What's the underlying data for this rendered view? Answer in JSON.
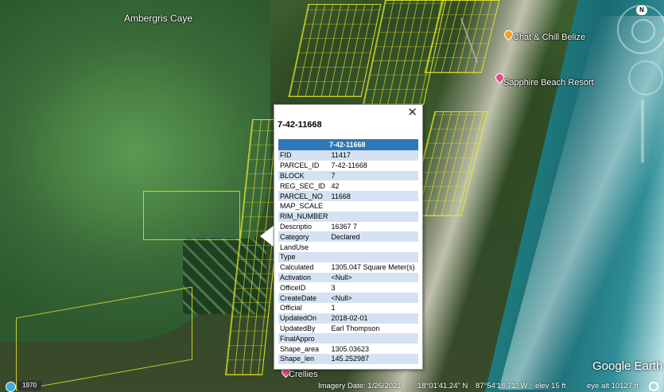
{
  "map": {
    "labels": {
      "ambergris": "Ambergris Caye",
      "chat_chill": "Chat & Chill Belize",
      "sapphire": "Sapphire Beach Resort",
      "crellies": "Crellies"
    },
    "pin_colors": {
      "chat_chill": "#f0a030",
      "sapphire": "#e24b8c",
      "crellies": "#e24b8c"
    },
    "compass_letter": "N",
    "logo": "Google Earth"
  },
  "popup": {
    "close_glyph": "✕",
    "heading": "7-42-11668",
    "table_title": "7-42-11668",
    "rows": [
      {
        "key": "FID",
        "value": "11417"
      },
      {
        "key": "PARCEL_ID",
        "value": "7-42-11668"
      },
      {
        "key": "BLOCK",
        "value": "7"
      },
      {
        "key": "REG_SEC_ID",
        "value": "42"
      },
      {
        "key": "PARCEL_NO",
        "value": "11668"
      },
      {
        "key": "MAP_SCALE",
        "value": ""
      },
      {
        "key": "RIM_NUMBER",
        "value": ""
      },
      {
        "key": "Descriptio",
        "value": "16367 7"
      },
      {
        "key": "Category",
        "value": "Declared"
      },
      {
        "key": "LandUse",
        "value": ""
      },
      {
        "key": "Type",
        "value": ""
      },
      {
        "key": "Calculated",
        "value": "1305.047 Square Meter(s)"
      },
      {
        "key": "Activation",
        "value": "<Null>"
      },
      {
        "key": "OfficeID",
        "value": "3"
      },
      {
        "key": "CreateDate",
        "value": "<Null>"
      },
      {
        "key": "Official",
        "value": "1"
      },
      {
        "key": "UpdatedOn",
        "value": "2018-02-01"
      },
      {
        "key": "UpdatedBy",
        "value": "Earl Thompson"
      },
      {
        "key": "FinalAppro",
        "value": ""
      },
      {
        "key": "Shape_area",
        "value": "1305.03623"
      },
      {
        "key": "Shape_len",
        "value": "145.252987"
      }
    ]
  },
  "status": {
    "year": "1970",
    "imagery_date": "Imagery Date: 1/26/2021",
    "lat": "18°01'41.24\" N",
    "lon": "87°54'18.71\" W",
    "elev": "elev   15 ft",
    "eye_alt": "eye alt  10127 ft"
  },
  "colors": {
    "accent": "#2e78b8",
    "row_alt": "#d4e2f2",
    "parcel_line": "#ebeb28"
  }
}
